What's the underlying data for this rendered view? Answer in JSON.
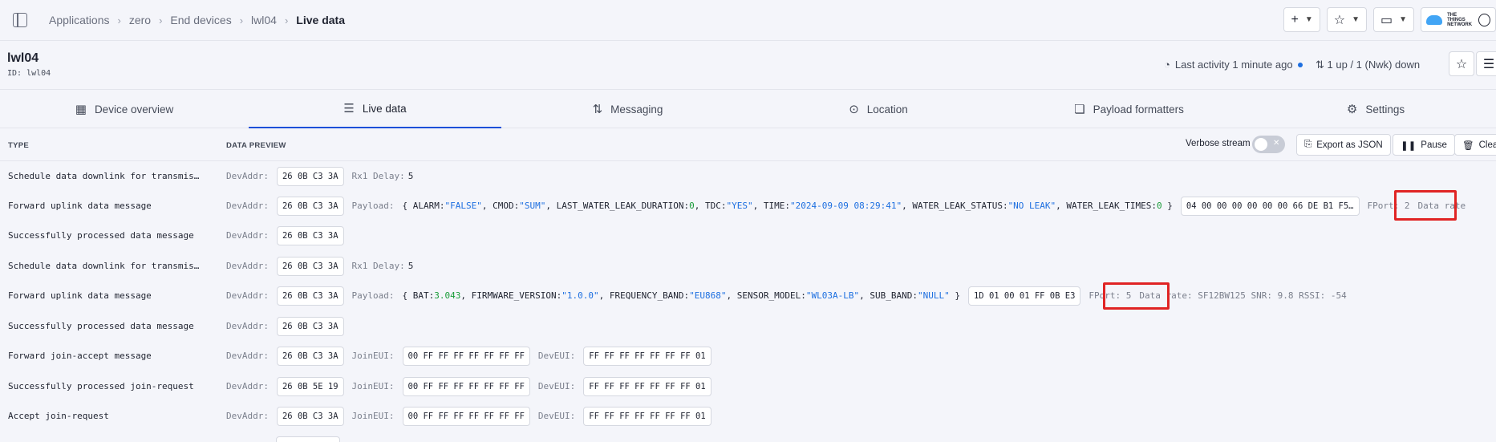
{
  "breadcrumb": [
    "Applications",
    "zero",
    "End devices",
    "lwl04",
    "Live data"
  ],
  "brand": {
    "line1": "THE THINGS",
    "line2": "NETWORK"
  },
  "device": {
    "name": "lwl04",
    "id": "ID: lwl04",
    "activity": "Last activity 1 minute ago",
    "updown": "1 up / 1 (Nwk) down"
  },
  "tabs": [
    {
      "label": "Device overview",
      "icon": "grid-icon"
    },
    {
      "label": "Live data",
      "icon": "list-icon"
    },
    {
      "label": "Messaging",
      "icon": "swap-icon"
    },
    {
      "label": "Location",
      "icon": "pin-icon"
    },
    {
      "label": "Payload formatters",
      "icon": "code-icon"
    },
    {
      "label": "Settings",
      "icon": "gear-icon"
    }
  ],
  "table": {
    "col_type": "TYPE",
    "col_preview": "DATA PREVIEW",
    "verbose": "Verbose stream",
    "export": "Export as JSON",
    "pause": "Pause",
    "clear": "Clear"
  },
  "rows": [
    {
      "type": "Schedule data downlink for transmission",
      "devaddr": "26 0B C3 3A",
      "extra_key": "Rx1 Delay:",
      "extra_val": "5"
    },
    {
      "type": "Forward uplink data message",
      "devaddr": "26 0B C3 3A",
      "payload": [
        "ALARM: ",
        "\"FALSE\"",
        ", CMOD: ",
        "\"SUM\"",
        ", LAST_WATER_LEAK_DURATION: ",
        "0",
        ", TDC: ",
        "\"YES\"",
        ", TIME: ",
        "\"2024-09-09 08:29:41\"",
        ", WATER_LEAK_STATUS: ",
        "\"NO LEAK\"",
        ", WATER_LEAK_TIMES: ",
        "0"
      ],
      "raw": "04 00 00 00 00 00 00 66 DE B1 F5…",
      "fport": "FPort: 2",
      "rest": "Data rate"
    },
    {
      "type": "Successfully processed data message",
      "devaddr": "26 0B C3 3A"
    },
    {
      "type": "Schedule data downlink for transmission",
      "devaddr": "26 0B C3 3A",
      "extra_key": "Rx1 Delay:",
      "extra_val": "5"
    },
    {
      "type": "Forward uplink data message",
      "devaddr": "26 0B C3 3A",
      "payload": [
        "BAT: ",
        "3.043",
        ", FIRMWARE_VERSION: ",
        "\"1.0.0\"",
        ", FREQUENCY_BAND: ",
        "\"EU868\"",
        ", SENSOR_MODEL: ",
        "\"WL03A-LB\"",
        ", SUB_BAND: ",
        "\"NULL\""
      ],
      "raw": "1D 01 00 01 FF 0B E3",
      "fport": "FPort: 5",
      "rest": "Data rate: SF12BW125  SNR: 9.8  RSSI: -54"
    },
    {
      "type": "Successfully processed data message",
      "devaddr": "26 0B C3 3A"
    },
    {
      "type": "Forward join-accept message",
      "devaddr": "26 0B C3 3A",
      "joineui": "00 FF FF FF FF FF FF FF",
      "deveui": "FF FF FF FF FF FF FF 01"
    },
    {
      "type": "Successfully processed join-request",
      "devaddr": "26 0B 5E 19",
      "joineui": "00 FF FF FF FF FF FF FF",
      "deveui": "FF FF FF FF FF FF FF 01"
    },
    {
      "type": "Accept join-request",
      "devaddr": "26 0B C3 3A",
      "joineui": "00 FF FF FF FF FF FF FF",
      "deveui": "FF FF FF FF FF FF FF 01"
    }
  ],
  "labels": {
    "devaddr": "DevAddr:",
    "payload": "Payload:",
    "joineui": "JoinEUI:",
    "deveui": "DevEUI:"
  }
}
